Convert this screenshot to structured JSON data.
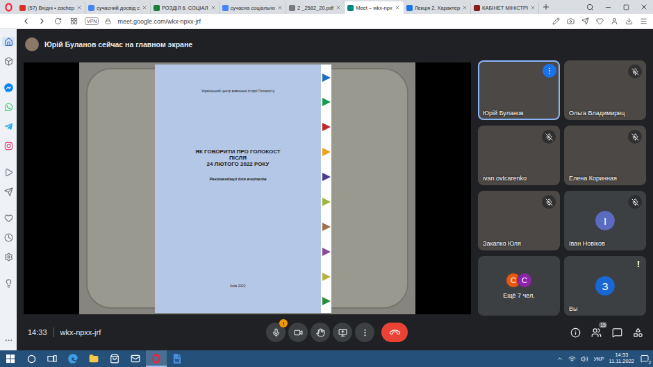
{
  "browser": {
    "tabs": [
      {
        "label": "(57) Вхідні • zachep",
        "selected": false,
        "color": "#d93025"
      },
      {
        "label": "сучасний досвід с",
        "selected": false,
        "color": "#4285f4"
      },
      {
        "label": "РОЗДІЛ 6. СОЦІАЛ",
        "selected": false,
        "color": "#188038"
      },
      {
        "label": "сучасна соціально",
        "selected": false,
        "color": "#4285f4"
      },
      {
        "label": "2 _2582_20.pdf",
        "selected": false,
        "color": "#7a7a7a"
      },
      {
        "label": "Meet – wkx-npx",
        "selected": true,
        "color": "#00897b"
      },
      {
        "label": "Лекція 2. Характер",
        "selected": false,
        "color": "#1a73e8"
      },
      {
        "label": "КАБІНЕТ МІНІСТРІ",
        "selected": false,
        "color": "#8b1a1a"
      }
    ]
  },
  "address_bar": {
    "vpn": "VPN",
    "url": "meet.google.com/wkx-npxx-jrf"
  },
  "sidebar": {
    "groups": [
      [
        {
          "kind": "home",
          "selected": true
        },
        {
          "kind": "box",
          "selected": false
        }
      ],
      [
        {
          "kind": "messenger",
          "selected": false
        },
        {
          "kind": "whatsapp",
          "selected": false
        },
        {
          "kind": "telegram",
          "selected": false
        },
        {
          "kind": "instagram",
          "selected": false
        }
      ],
      [
        {
          "kind": "player",
          "selected": false
        },
        {
          "kind": "send",
          "selected": false
        }
      ],
      [
        {
          "kind": "heart",
          "selected": false
        },
        {
          "kind": "history",
          "selected": false
        },
        {
          "kind": "settings",
          "selected": false
        }
      ],
      [
        {
          "kind": "bulb",
          "selected": false
        }
      ]
    ],
    "bottom": [
      {
        "kind": "more",
        "selected": false
      }
    ]
  },
  "meet": {
    "banner": "Юрій Буланов сейчас на главном экране",
    "presentation": {
      "organization": "Український центр вивчення історії Голокосту",
      "title": [
        "ЯК ГОВОРИТИ ПРО ГОЛОКОСТ",
        "ПІСЛЯ",
        "24 ЛЮТОГО 2022 РОКУ"
      ],
      "subtitle": "Рекомендації для вчителів",
      "footer": "Київ 2022",
      "tabs": [
        {
          "color": "#1e6fbf"
        },
        {
          "color": "#1a9a4a"
        },
        {
          "color": "#c0282d"
        },
        {
          "color": "#f0a020"
        },
        {
          "color": "#4a3f8f"
        },
        {
          "color": "#9ab83a"
        },
        {
          "color": "#a0704a"
        },
        {
          "color": "#8a4a9a"
        },
        {
          "color": "#b8b040"
        },
        {
          "color": "#2e8b3e"
        }
      ]
    },
    "participants": [
      {
        "kind": "video",
        "name": "Юрій Буланов",
        "muted": false,
        "selected": true,
        "options_shown": true
      },
      {
        "kind": "video",
        "name": "Ольга Владимирец",
        "muted": true,
        "selected": false,
        "options_shown": false
      },
      {
        "kind": "video",
        "name": "ivan ovtcarenko",
        "muted": true,
        "selected": false,
        "options_shown": false
      },
      {
        "kind": "video",
        "name": "Елена Коринная",
        "muted": true,
        "selected": false,
        "options_shown": false
      },
      {
        "kind": "video",
        "name": "Закапко Юля",
        "muted": true,
        "selected": false,
        "options_shown": false
      },
      {
        "kind": "avatar",
        "name": "Іван Новіков",
        "initial": "І",
        "color": "#5c6bc0",
        "muted": true,
        "selected": false,
        "options_shown": false
      },
      {
        "kind": "overflow",
        "label": "Ещё 7 чел.",
        "avatars": [
          {
            "initial": "С",
            "color": "#e8570e"
          },
          {
            "initial": "С",
            "color": "#8e24aa"
          }
        ],
        "selected": false
      },
      {
        "kind": "self",
        "name": "Вы",
        "initial": "З",
        "color": "#1967d2",
        "alert": "!",
        "muted": false,
        "selected": false,
        "options_shown": false
      }
    ],
    "bar": {
      "time": "14:33",
      "code": "wkx-npxx-jrf",
      "mic_alert": "!",
      "people_count": "15"
    }
  },
  "taskbar": {
    "apps": [
      {
        "kind": "start",
        "selected": false
      },
      {
        "kind": "search",
        "selected": false
      },
      {
        "kind": "taskview",
        "selected": false
      },
      {
        "kind": "edge",
        "selected": false
      },
      {
        "kind": "explorer",
        "selected": false
      },
      {
        "kind": "store",
        "selected": false
      },
      {
        "kind": "mail",
        "selected": false
      },
      {
        "kind": "opera",
        "selected": true
      },
      {
        "kind": "word",
        "selected": false
      }
    ],
    "tray": {
      "language": "УКР",
      "time": "14:33",
      "date": "11.11.2022",
      "notifications": "2"
    }
  }
}
